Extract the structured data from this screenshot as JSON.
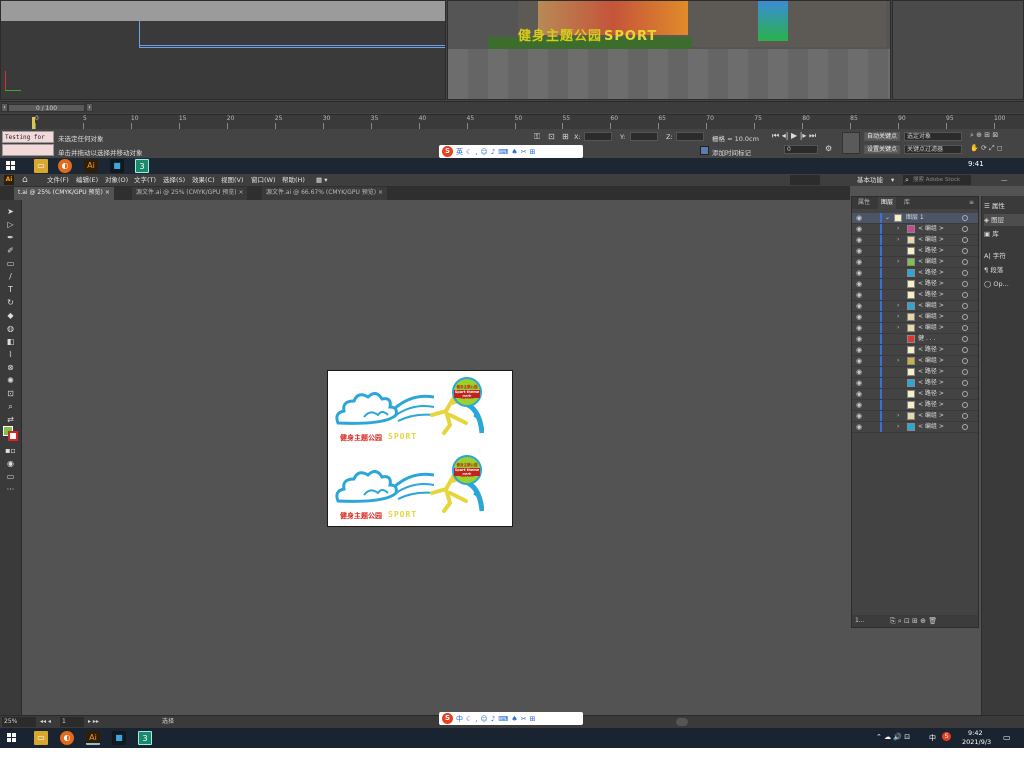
{
  "max": {
    "viewport_title": "健身主题公园",
    "viewport_sport": "SPORT",
    "frame_counter": "0 / 100",
    "ruler_ticks": [
      "0",
      "5",
      "10",
      "15",
      "20",
      "25",
      "30",
      "35",
      "40",
      "45",
      "50",
      "55",
      "60",
      "65",
      "70",
      "75",
      "80",
      "85",
      "90",
      "95",
      "100"
    ],
    "prompt_line1": "Testing for ALL",
    "status_line1": "未选定任何对象",
    "status_line2": "单击并拖动以选择并移动对象",
    "x_label": "X:",
    "y_label": "Y:",
    "z_label": "Z:",
    "grid_label": "栅格 = 10.0cm",
    "add_time_tag": "添加时间标记",
    "auto_key": "自动关键点",
    "set_key": "设置关键点",
    "selected_object": "选定对象",
    "key_filter": "关键点过滤器",
    "frame_field": "0"
  },
  "taskbar_top": {
    "time": "9:41"
  },
  "ai": {
    "menu": [
      "文件(F)",
      "编辑(E)",
      "对象(O)",
      "文字(T)",
      "选择(S)",
      "效果(C)",
      "视图(V)",
      "窗口(W)",
      "帮助(H)"
    ],
    "workspace": "基本功能",
    "search_placeholder": "搜索 Adobe Stock",
    "tabs": [
      {
        "label": "t.ai @ 25% (CMYK/GPU 预览)"
      },
      {
        "label": "源文件.ai @ 25% (CMYK/GPU 预览)"
      },
      {
        "label": "源文件.ai @ 66.67% (CMYK/GPU 预览)"
      }
    ],
    "artboard": {
      "sign_title": "健身主题公园",
      "sign_sport": "SPORT",
      "ball_line1": "健身主题公园",
      "ball_line2": "Sport theme park",
      "ball_line3": "6899M"
    },
    "status": {
      "zoom": "25%",
      "artboard_num": "1",
      "tool": "选择"
    }
  },
  "layers": {
    "tabs": [
      "属性",
      "图层",
      "库"
    ],
    "rows": [
      {
        "label": "图层 1",
        "expanded": true,
        "top": true
      },
      {
        "label": "< 编组 >",
        "arrow": true
      },
      {
        "label": "< 编组 >",
        "arrow": true
      },
      {
        "label": "< 路径 >",
        "arrow": false
      },
      {
        "label": "< 编组 >",
        "arrow": true
      },
      {
        "label": "< 路径 >",
        "arrow": false
      },
      {
        "label": "< 路径 >",
        "arrow": false
      },
      {
        "label": "< 路径 >",
        "arrow": false
      },
      {
        "label": "< 编组 >",
        "arrow": true
      },
      {
        "label": "< 编组 >",
        "arrow": true
      },
      {
        "label": "< 编组 >",
        "arrow": true
      },
      {
        "label": "健 . . .",
        "arrow": false
      },
      {
        "label": "< 路径 >",
        "arrow": false
      },
      {
        "label": "< 编组 >",
        "arrow": true
      },
      {
        "label": "< 路径 >",
        "arrow": false
      },
      {
        "label": "< 路径 >",
        "arrow": false
      },
      {
        "label": "< 路径 >",
        "arrow": false
      },
      {
        "label": "< 路径 >",
        "arrow": false
      },
      {
        "label": "< 编组 >",
        "arrow": true
      },
      {
        "label": "< 编组 >",
        "arrow": true
      }
    ],
    "footer": "1..."
  },
  "dock": {
    "items": [
      "属性",
      "图层",
      "库",
      "字符",
      "段落",
      "Op..."
    ]
  },
  "taskbar_bottom": {
    "time": "9:42",
    "date": "2021/9/3",
    "ime": "中"
  },
  "sogou": {
    "label": "英",
    "label2": "中"
  },
  "colors": {
    "ai_bg": "#535353",
    "accent_blue": "#3d6fd8",
    "sign_red": "#d9251d",
    "sign_yellow": "#e6d53c",
    "sign_blue": "#2aa6d8",
    "sign_green": "#9bd12c"
  }
}
